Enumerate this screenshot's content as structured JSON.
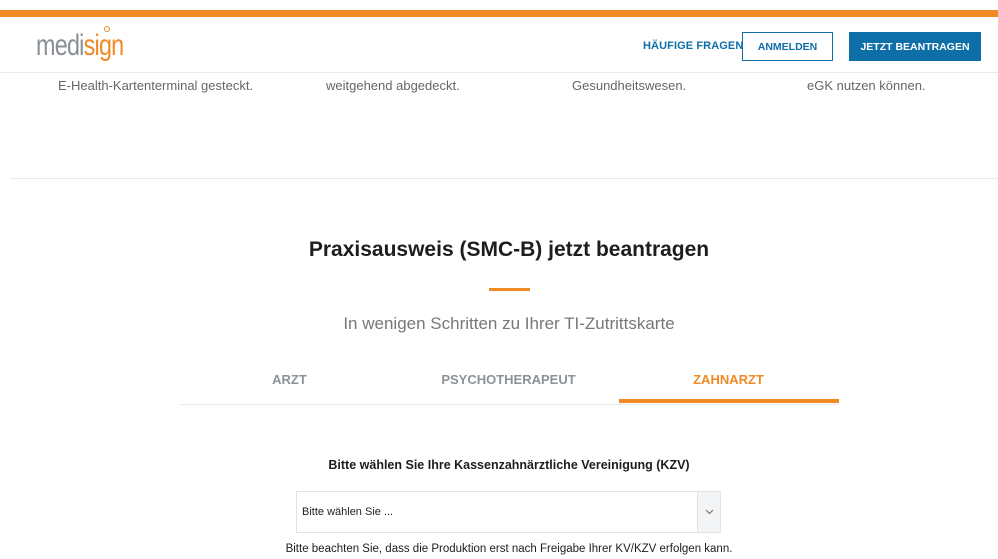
{
  "brand": {
    "logo_text_part1": "medi",
    "logo_text_part2": "sign",
    "accent_color": "#f08a24",
    "primary_color": "#0e6ea8"
  },
  "header": {
    "faq_label": "HÄUFIGE FRAGEN",
    "login_label": "ANMELDEN",
    "apply_label": "JETZT BEANTRAGEN"
  },
  "features": [
    {
      "text": "E-Health-Kartenterminal gesteckt."
    },
    {
      "text": "weitgehend abgedeckt."
    },
    {
      "text": "Gesundheitswesen."
    },
    {
      "text": "eGK nutzen können."
    }
  ],
  "section": {
    "title": "Praxisausweis (SMC-B) jetzt beantragen",
    "subtitle": "In wenigen Schritten zu Ihrer TI-Zutrittskarte"
  },
  "tabs": [
    {
      "label": "ARZT",
      "active": false
    },
    {
      "label": "PSYCHOTHERAPEUT",
      "active": false
    },
    {
      "label": "ZAHNARZT",
      "active": true
    }
  ],
  "form": {
    "select_label": "Bitte wählen Sie Ihre Kassenzahnärztliche Vereinigung (KZV)",
    "select_value": "Bitte wählen Sie ...",
    "note": "Bitte beachten Sie, dass die Produktion erst nach Freigabe Ihrer KV/KZV erfolgen kann."
  }
}
